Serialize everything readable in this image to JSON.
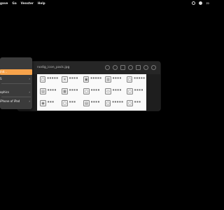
{
  "menubar": {
    "items": [
      "gave",
      "Ga",
      "Venster",
      "Help"
    ],
    "clock": "zo"
  },
  "window": {
    "title": "nodig_icon_pack.jpg",
    "grid_items": [
      {
        "label": "■ ■ ■ ■ ■",
        "glyph": "▢"
      },
      {
        "label": "■ ■ ■ ■",
        "glyph": "✕"
      },
      {
        "label": "■ ■ ■ ■ ■",
        "glyph": "▣"
      },
      {
        "label": "■ ■ ■ ■",
        "glyph": "▥"
      },
      {
        "label": "■ ■ ■ ■ ■",
        "glyph": "▢"
      },
      {
        "label": "■ ■ ■ ■",
        "glyph": "▤"
      },
      {
        "label": "■ ■ ■ ■",
        "glyph": "▦"
      },
      {
        "label": "■ ■ ■ ■",
        "glyph": "▢"
      },
      {
        "label": "■ ■ ■ ■",
        "glyph": "▭"
      },
      {
        "label": "■ ■ ■ ■",
        "glyph": "▢"
      },
      {
        "label": "■ ■ ■",
        "glyph": "◉"
      },
      {
        "label": "■ ■ ■",
        "glyph": "▢"
      },
      {
        "label": "■ ■ ■ ■",
        "glyph": "▤"
      },
      {
        "label": "■ ■ ■ ■ ■",
        "glyph": "▢"
      },
      {
        "label": "■ ■ ■",
        "glyph": "▢"
      }
    ]
  },
  "context_menu": {
    "items": [
      {
        "label": "ind...",
        "selected": true,
        "arrow": ""
      },
      {
        "label": "S",
        "selected": false,
        "arrow": "›"
      },
      {
        "label": "",
        "selected": false,
        "arrow": ""
      },
      {
        "label": "aphics",
        "selected": false,
        "arrow": "›"
      },
      {
        "label": "",
        "selected": false,
        "arrow": ""
      },
      {
        "label": "iPhone of iPad",
        "selected": false,
        "arrow": "›"
      }
    ]
  },
  "colors": {
    "selection": "#f7a34b",
    "menu_bg": "#3b3b3b",
    "window_bg": "#1e1e1e",
    "canvas_bg": "#fafafa"
  }
}
